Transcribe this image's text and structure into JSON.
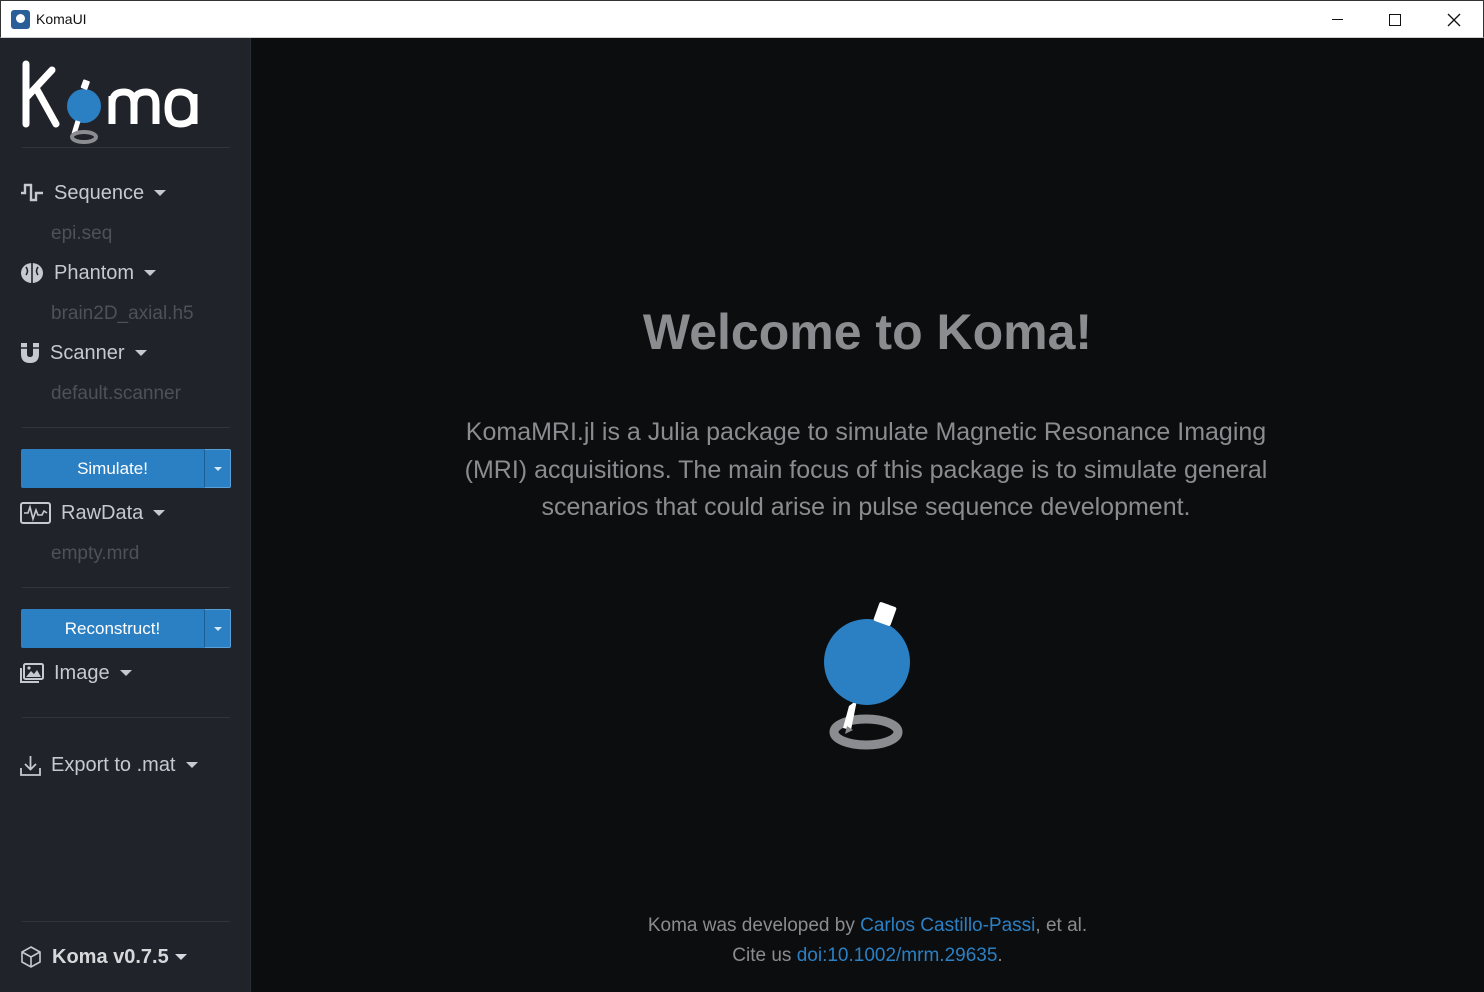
{
  "window": {
    "title": "KomaUI",
    "minimize_icon": "minimize-icon",
    "maximize_icon": "maximize-icon",
    "close_icon": "close-icon"
  },
  "sidebar": {
    "logo": "Koma",
    "sequence": {
      "label": "Sequence",
      "icon": "waveform-icon",
      "file": "epi.seq"
    },
    "phantom": {
      "label": "Phantom",
      "icon": "brain-icon",
      "file": "brain2D_axial.h5"
    },
    "scanner": {
      "label": "Scanner",
      "icon": "magnet-icon",
      "file": "default.scanner"
    },
    "simulate_button": "Simulate!",
    "rawdata": {
      "label": "RawData",
      "icon": "rawdata-icon",
      "file": "empty.mrd"
    },
    "reconstruct_button": "Reconstruct!",
    "image": {
      "label": "Image",
      "icon": "image-icon"
    },
    "export": {
      "label": "Export to .mat",
      "icon": "download-icon"
    },
    "version": {
      "label": "Koma v0.7.5",
      "icon": "cube-icon"
    }
  },
  "main": {
    "welcome": "Welcome to Koma!",
    "description": "KomaMRI.jl is a Julia package to simulate Magnetic Resonance Imaging (MRI) acquisitions. The main focus of this package is to simulate general scenarios that could arise in pulse sequence development.",
    "credit_prefix": "Koma was developed by ",
    "credit_author": "Carlos Castillo-Passi",
    "credit_suffix": ", et al.",
    "cite_prefix": "Cite us ",
    "cite_doi": "doi:10.1002/mrm.29635",
    "cite_suffix": "."
  },
  "colors": {
    "accent": "#2b80c4",
    "sidebar_bg": "#202329",
    "main_bg": "#0c0d0f",
    "text_muted": "#8a8c90"
  }
}
